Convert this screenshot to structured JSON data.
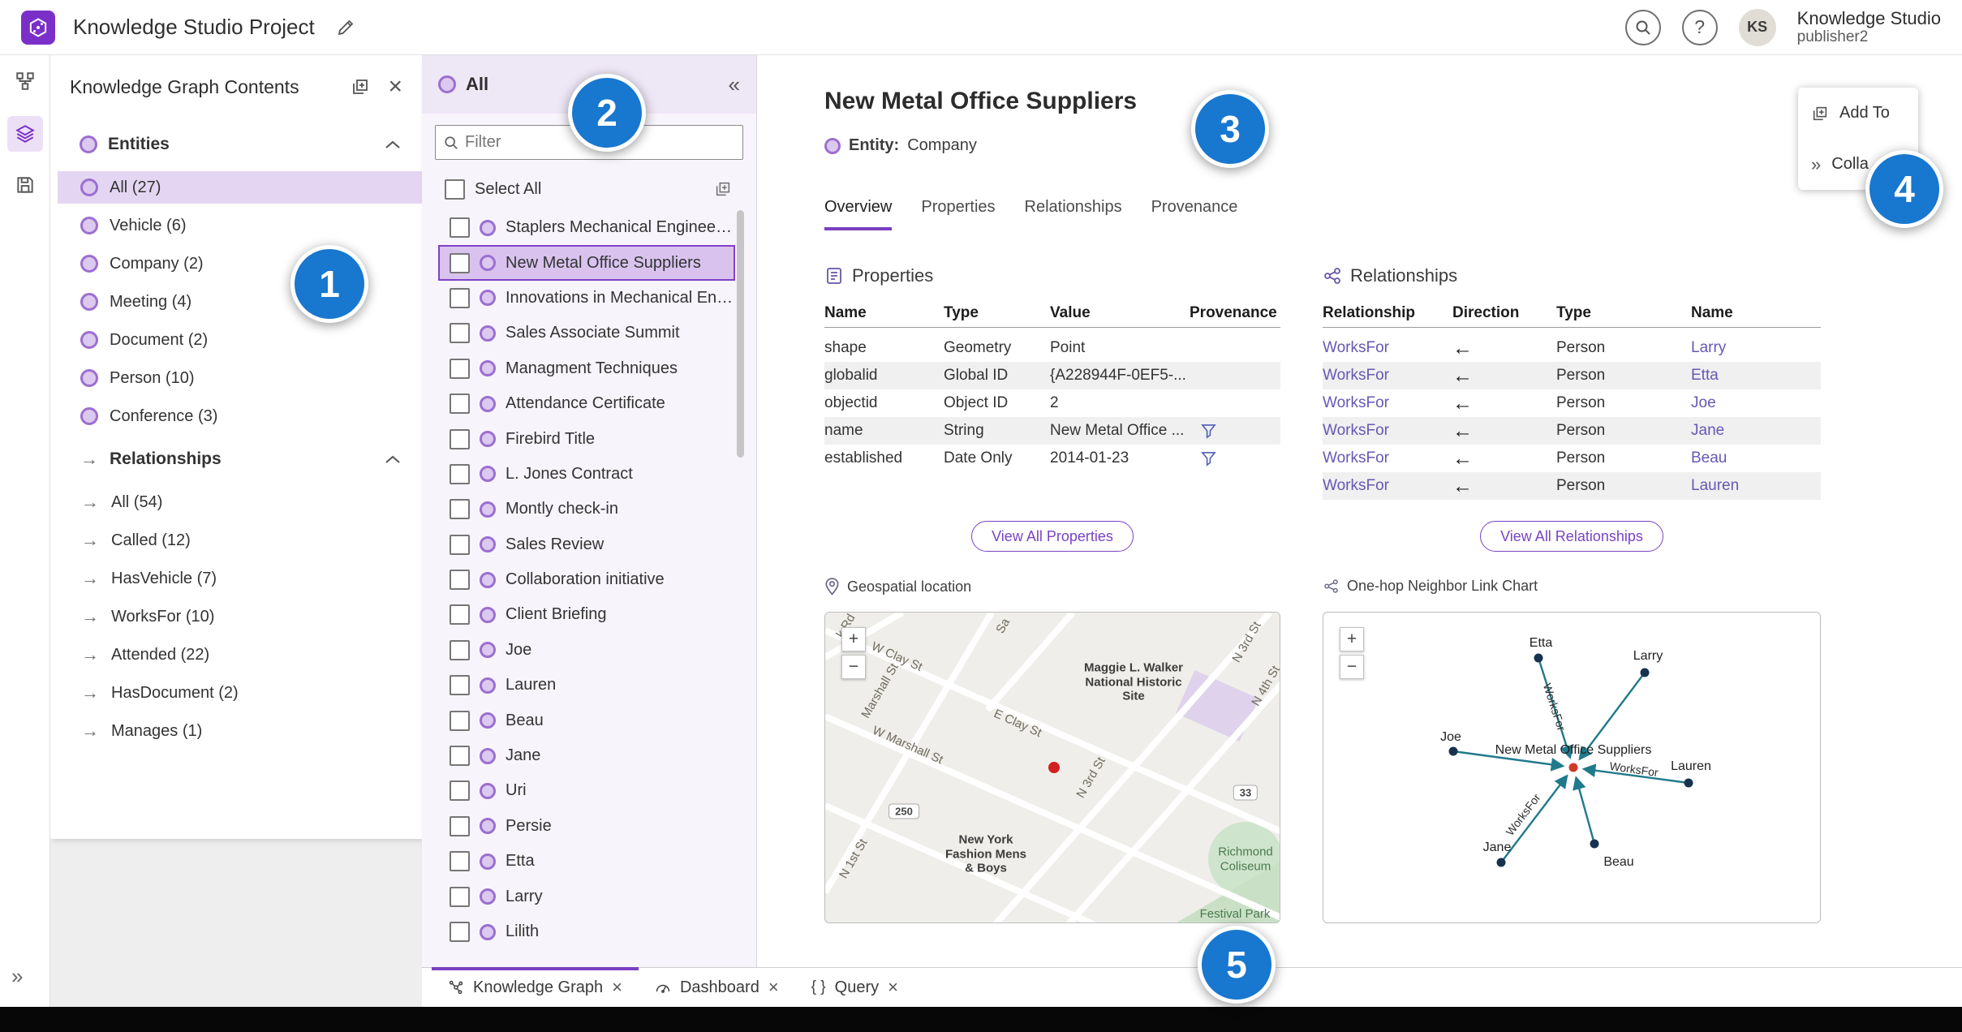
{
  "header": {
    "title": "Knowledge Studio Project",
    "account_name": "Knowledge Studio",
    "account_role": "publisher2",
    "avatar_initials": "KS"
  },
  "contents_panel": {
    "title": "Knowledge Graph Contents",
    "entities_section": "Entities",
    "entities": [
      {
        "label": "All (27)",
        "selected": true
      },
      {
        "label": "Vehicle (6)"
      },
      {
        "label": "Company (2)"
      },
      {
        "label": "Meeting (4)"
      },
      {
        "label": "Document (2)"
      },
      {
        "label": "Person (10)"
      },
      {
        "label": "Conference (3)"
      }
    ],
    "relationships_section": "Relationships",
    "relationships": [
      {
        "label": "All (54)"
      },
      {
        "label": "Called (12)"
      },
      {
        "label": "HasVehicle (7)"
      },
      {
        "label": "WorksFor (10)"
      },
      {
        "label": "Attended (22)"
      },
      {
        "label": "HasDocument (2)"
      },
      {
        "label": "Manages (1)"
      }
    ]
  },
  "list_panel": {
    "title": "All",
    "filter_placeholder": "Filter",
    "select_all": "Select All",
    "items": [
      {
        "label": "Staplers Mechanical Engineering"
      },
      {
        "label": "New Metal Office Suppliers",
        "selected": true
      },
      {
        "label": "Innovations in Mechanical Engin..."
      },
      {
        "label": "Sales Associate Summit"
      },
      {
        "label": "Managment Techniques"
      },
      {
        "label": "Attendance Certificate"
      },
      {
        "label": "Firebird Title"
      },
      {
        "label": "L. Jones Contract"
      },
      {
        "label": "Montly check-in"
      },
      {
        "label": "Sales Review"
      },
      {
        "label": "Collaboration initiative"
      },
      {
        "label": "Client Briefing"
      },
      {
        "label": "Joe"
      },
      {
        "label": "Lauren"
      },
      {
        "label": "Beau"
      },
      {
        "label": "Jane"
      },
      {
        "label": "Uri"
      },
      {
        "label": "Persie"
      },
      {
        "label": "Etta"
      },
      {
        "label": "Larry"
      },
      {
        "label": "Lilith"
      }
    ]
  },
  "detail": {
    "title": "New Metal Office Suppliers",
    "entity_key": "Entity:",
    "entity_type": "Company",
    "tabs": [
      {
        "label": "Overview",
        "active": true
      },
      {
        "label": "Properties"
      },
      {
        "label": "Relationships"
      },
      {
        "label": "Provenance"
      }
    ],
    "menu": {
      "add_to": "Add To",
      "collapse": "Colla"
    },
    "properties": {
      "title": "Properties",
      "columns": [
        "Name",
        "Type",
        "Value",
        "Provenance"
      ],
      "rows": [
        {
          "name": "shape",
          "type": "Geometry",
          "value": "Point",
          "provenance": false
        },
        {
          "name": "globalid",
          "type": "Global ID",
          "value": "{A228944F-0EF5-...",
          "provenance": false
        },
        {
          "name": "objectid",
          "type": "Object ID",
          "value": "2",
          "provenance": false
        },
        {
          "name": "name",
          "type": "String",
          "value": "New Metal Office ...",
          "provenance": true
        },
        {
          "name": "established",
          "type": "Date Only",
          "value": "2014-01-23",
          "provenance": true
        }
      ],
      "view_all": "View All Properties"
    },
    "relationships": {
      "title": "Relationships",
      "columns": [
        "Relationship",
        "Direction",
        "Type",
        "Name"
      ],
      "rows": [
        {
          "relationship": "WorksFor",
          "direction": "←",
          "type": "Person",
          "name": "Larry"
        },
        {
          "relationship": "WorksFor",
          "direction": "←",
          "type": "Person",
          "name": "Etta"
        },
        {
          "relationship": "WorksFor",
          "direction": "←",
          "type": "Person",
          "name": "Joe"
        },
        {
          "relationship": "WorksFor",
          "direction": "←",
          "type": "Person",
          "name": "Jane"
        },
        {
          "relationship": "WorksFor",
          "direction": "←",
          "type": "Person",
          "name": "Beau"
        },
        {
          "relationship": "WorksFor",
          "direction": "←",
          "type": "Person",
          "name": "Lauren"
        }
      ],
      "view_all": "View All Relationships"
    },
    "geospatial": {
      "title": "Geospatial location",
      "streets": [
        "k Rd",
        "W Clay St",
        "Sa",
        "N 3rd St",
        "N 4th St",
        "E Clay St",
        "Marshall St",
        "W Marshall St",
        "N 3rd St",
        "N 1st St"
      ],
      "shields": [
        "250",
        "33"
      ],
      "places": [
        "Maggie L. Walker National Historic Site",
        "New York Fashion Mens & Boys",
        "Richmond Coliseum",
        "Festival Park"
      ]
    },
    "link_chart": {
      "title": "One-hop Neighbor Link Chart",
      "center_label": "New Metal Office Suppliers",
      "edge_label": "WorksFor",
      "nodes": [
        "Etta",
        "Larry",
        "Joe",
        "Lauren",
        "Jane",
        "Beau"
      ]
    }
  },
  "bottom_tabs": [
    {
      "label": "Knowledge Graph",
      "active": true
    },
    {
      "label": "Dashboard"
    },
    {
      "label": "Query"
    }
  ],
  "callouts": [
    "1",
    "2",
    "3",
    "4",
    "5"
  ],
  "colors": {
    "accent_purple": "#8140c8",
    "selection_fill": "#d9c3ee",
    "link_purple": "#6658b4",
    "edge_teal": "#1f7a8c",
    "node_navy": "#16324f",
    "marker_red": "#d21f1f",
    "badge_blue": "#1877cf"
  }
}
